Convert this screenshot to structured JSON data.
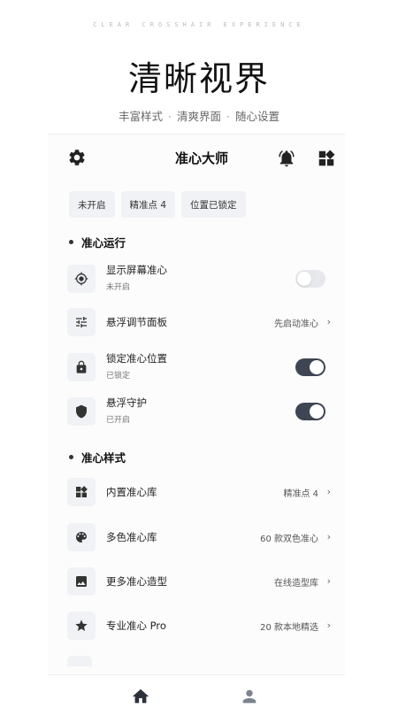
{
  "hero": {
    "tagline": "CLEAR CROSSHAIR EXPERIENCE",
    "title": "清晰视界",
    "subtitle_parts": [
      "丰富样式",
      "清爽界面",
      "随心设置"
    ],
    "separator": "·"
  },
  "header": {
    "title": "准心大师",
    "left_icon": "gear-icon",
    "right_icons": [
      "bell-icon",
      "widgets-icon"
    ]
  },
  "chips": [
    "未开启",
    "精准点 4",
    "位置已锁定"
  ],
  "section_run": {
    "title": "准心运行",
    "rows": [
      {
        "label": "显示屏幕准心",
        "sub": "未开启",
        "control": "toggle",
        "on": false,
        "icon": "crosshair-icon"
      },
      {
        "label": "悬浮调节面板",
        "value": "先启动准心",
        "chevron": "›",
        "control": "link",
        "icon": "sliders-icon"
      },
      {
        "label": "锁定准心位置",
        "sub": "已锁定",
        "control": "toggle",
        "on": true,
        "icon": "lock-icon"
      },
      {
        "label": "悬浮守护",
        "sub": "已开启",
        "control": "toggle",
        "on": true,
        "icon": "shield-icon"
      }
    ]
  },
  "section_style": {
    "title": "准心样式",
    "rows": [
      {
        "label": "内置准心库",
        "value": "精准点 4",
        "chevron": "›",
        "icon": "widgets-icon"
      },
      {
        "label": "多色准心库",
        "value": "60 款双色准心",
        "chevron": "›",
        "icon": "palette-icon"
      },
      {
        "label": "更多准心造型",
        "value": "在线造型库",
        "chevron": "›",
        "icon": "image-icon"
      },
      {
        "label": "专业准心 Pro",
        "value": "20 款本地精选",
        "chevron": "›",
        "icon": "star-icon"
      }
    ]
  },
  "bottom_nav": {
    "items": [
      "home-icon",
      "profile-icon"
    ],
    "active": "home-icon"
  },
  "colors": {
    "accent": "#3f4553",
    "chip_bg": "#f0f2f5",
    "toggle_off": "#e6e8ec"
  }
}
